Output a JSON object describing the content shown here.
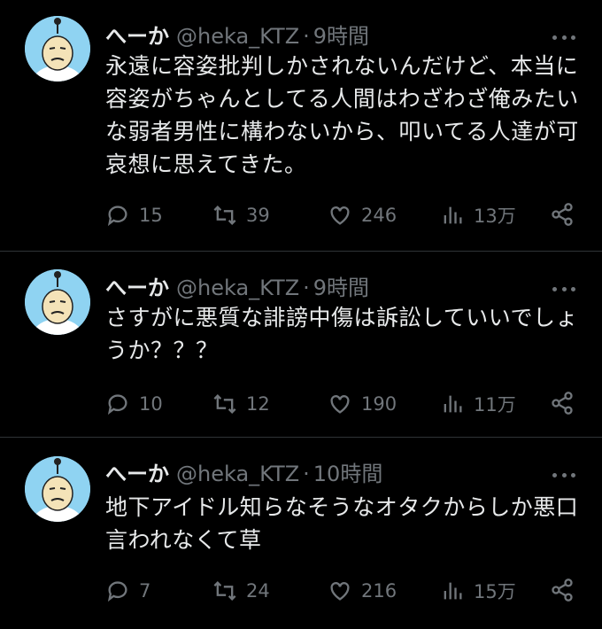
{
  "tweets": [
    {
      "name": "へーか",
      "handle": "@heka_KTZ",
      "dot": "·",
      "time": "9時間",
      "text": "永遠に容姿批判しかされないんだけど、本当に\n容姿がちゃんとしてる人間はわざわざ俺みたい\nな弱者男性に構わないから、叩いてる人達が可\n哀想に思えてきた。",
      "replies": "15",
      "retweets": "39",
      "likes": "246",
      "views": "13万"
    },
    {
      "name": "へーか",
      "handle": "@heka_KTZ",
      "dot": "·",
      "time": "9時間",
      "text": "さすがに悪質な誹謗中傷は訴訟していいでしょ\nうか？？？",
      "replies": "10",
      "retweets": "12",
      "likes": "190",
      "views": "11万"
    },
    {
      "name": "へーか",
      "handle": "@heka_KTZ",
      "dot": "·",
      "time": "10時間",
      "text": "地下アイドル知らなそうなオタクからしか悪口\n言われなくて草",
      "replies": "7",
      "retweets": "24",
      "likes": "216",
      "views": "15万"
    }
  ],
  "icons": {
    "reply": "reply-icon",
    "retweet": "retweet-icon",
    "like": "heart-icon",
    "views": "views-icon",
    "share": "share-icon",
    "more": "more-icon"
  },
  "colors": {
    "background": "#000000",
    "text": "#e7e9ea",
    "muted": "#71767b",
    "divider": "#2f3336",
    "avatar": "#8fd3f2"
  }
}
